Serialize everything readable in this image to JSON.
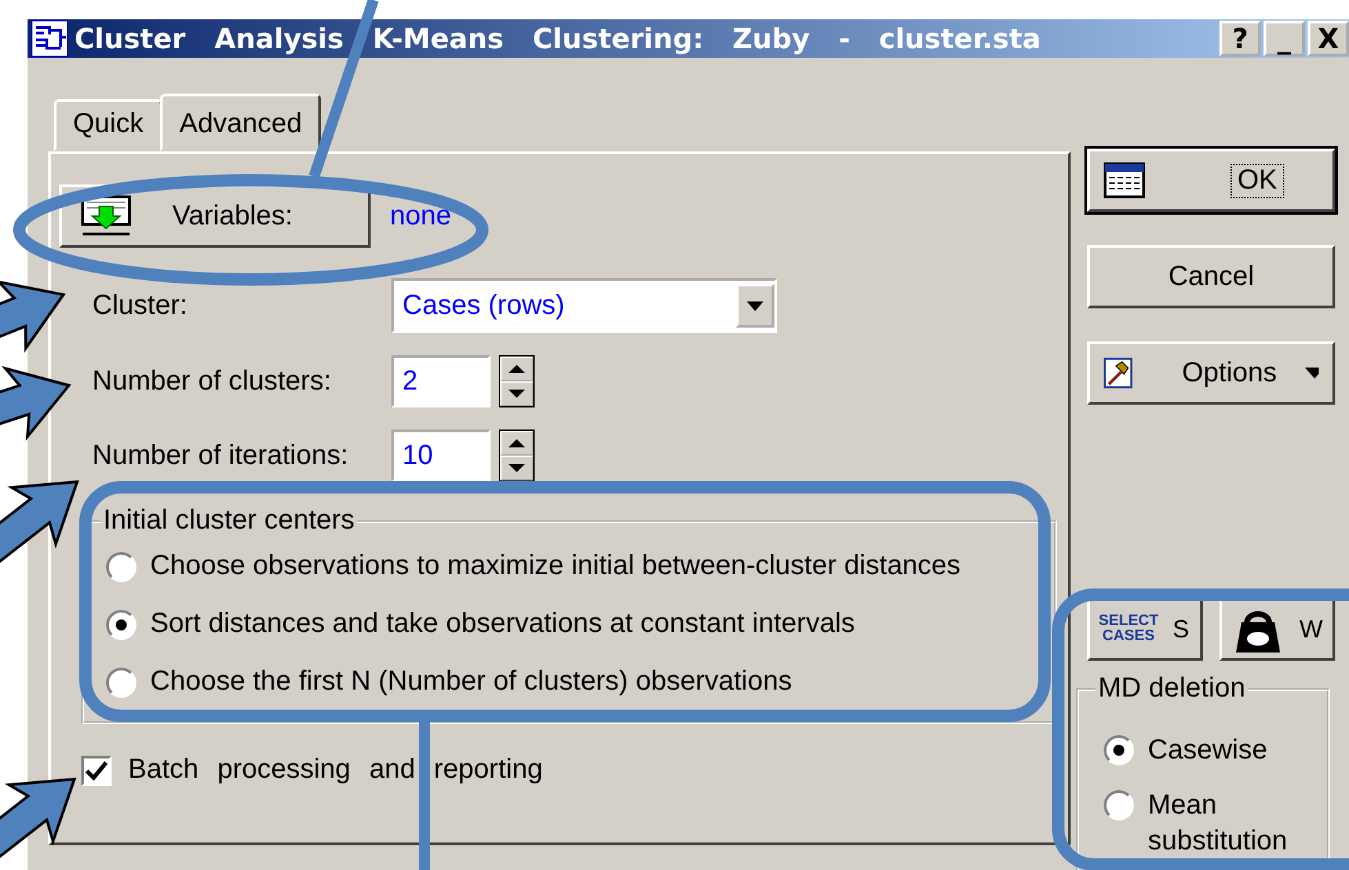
{
  "window": {
    "title": "Cluster Analysis K-Means Clustering: Zuby - cluster.sta",
    "controls": [
      "?",
      "_",
      "X"
    ]
  },
  "tabs": [
    {
      "label": "Quick",
      "selected": false
    },
    {
      "label": "Advanced",
      "selected": true
    }
  ],
  "variables": {
    "button": "Variables:",
    "value": "none"
  },
  "fields": [
    {
      "label": "Cluster:",
      "value": "Cases (rows)",
      "kind": "dropdown"
    },
    {
      "label": "Number of clusters:",
      "value": "2",
      "kind": "spinner"
    },
    {
      "label": "Number of iterations:",
      "value": "10",
      "kind": "spinner"
    }
  ],
  "initial_cluster_centers": {
    "title": "Initial cluster centers",
    "options": [
      {
        "label": "Choose observations to maximize initial between-cluster distances",
        "selected": false
      },
      {
        "label": "Sort distances and take observations at constant intervals",
        "selected": true
      },
      {
        "label": "Choose the first N (Number of clusters) observations",
        "selected": false
      }
    ]
  },
  "batch": {
    "label": "Batch processing and reporting",
    "checked": true
  },
  "buttons": [
    {
      "label": "OK",
      "kind": "ok"
    },
    {
      "label": "Cancel",
      "kind": "plain"
    },
    {
      "label": "Options",
      "kind": "menu"
    }
  ],
  "small_buttons": [
    {
      "label": "S",
      "icon_text": "SELECT CASES",
      "kind": "select-cases"
    },
    {
      "label": "W",
      "kind": "weight"
    }
  ],
  "md_deletion": {
    "title": "MD deletion",
    "options": [
      {
        "label": "Casewise",
        "selected": true
      },
      {
        "label": "Mean substitution",
        "selected": false
      }
    ]
  },
  "annotations": [
    {
      "kind": "pointer-line"
    },
    {
      "kind": "ellipse"
    },
    {
      "kind": "arrow"
    },
    {
      "kind": "arrow"
    },
    {
      "kind": "arrow"
    },
    {
      "kind": "arrow"
    },
    {
      "kind": "frame"
    },
    {
      "kind": "pointer-line"
    },
    {
      "kind": "frame"
    }
  ]
}
